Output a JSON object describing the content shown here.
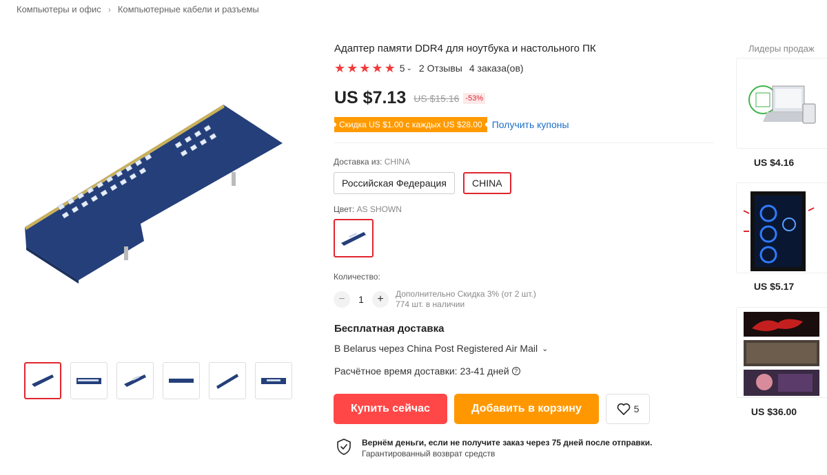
{
  "breadcrumb": {
    "items": [
      "Компьютеры и офис",
      "Компьютерные кабели и разъемы"
    ],
    "separator": "›"
  },
  "product": {
    "title": "Адаптер памяти DDR4 для ноутбука и настольного ПК",
    "rating": "5",
    "reviews": "2 Отзывы",
    "orders": "4 заказа(ов)",
    "price": "US $7.13",
    "old_price": "US $15.16",
    "discount": "-53%",
    "coupon": "Скидка US $1.00 с каждых US $28.00",
    "coupon_link": "Получить купоны"
  },
  "ship_from": {
    "label": "Доставка из:",
    "value": "CHINA",
    "options": [
      "Российская Федерация",
      "CHINA"
    ]
  },
  "color": {
    "label": "Цвет:",
    "value": "AS SHOWN"
  },
  "quantity": {
    "label": "Количество:",
    "value": "1",
    "minus": "−",
    "plus": "+",
    "discount_note": "Дополнительно Скидка 3% (от 2 шт.)",
    "stock": "774 шт. в наличии"
  },
  "shipping": {
    "title": "Бесплатная доставка",
    "method": "В Belarus через China Post Registered Air Mail",
    "time": "Расчётное время доставки: 23-41 дней"
  },
  "actions": {
    "buy": "Купить сейчас",
    "cart": "Добавить в корзину",
    "wish_count": "5"
  },
  "guarantee": {
    "line1": "Вернём деньги, если не получите заказ через 75 дней после отправки.",
    "line2": "Гарантированный возврат средств"
  },
  "top_sellers": {
    "title": "Лидеры продаж",
    "items": [
      {
        "price": "US $4.16"
      },
      {
        "price": "US $5.17"
      },
      {
        "price": "US $36.00"
      }
    ]
  },
  "colors": {
    "accent_red": "#ff4747",
    "accent_orange": "#ff9800",
    "link_blue": "#1a6ec7",
    "pcb_blue": "#243f7a"
  }
}
